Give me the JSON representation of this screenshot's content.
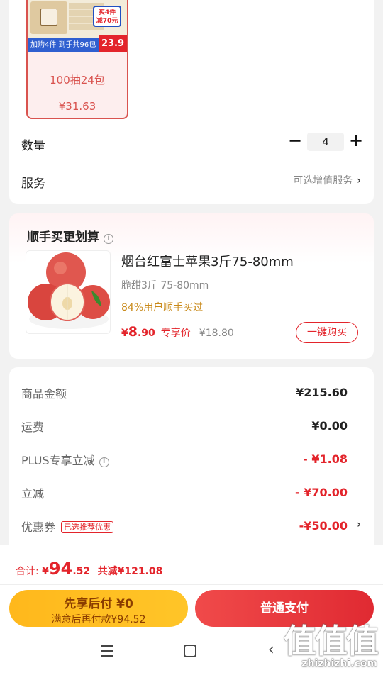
{
  "sku_card": {
    "variant": {
      "promo_badge": "买4件\n减70元",
      "strip_text": "加购4件 到手共96包",
      "price_tag": "23.9",
      "name": "100抽24包",
      "price": "¥31.63"
    },
    "quantity": {
      "label": "数量",
      "minus": "−",
      "value": "4",
      "plus": "+"
    },
    "service": {
      "label": "服务",
      "option": "可选增值服务",
      "chevron": "›"
    }
  },
  "upsell": {
    "title": "顺手买更划算",
    "info_icon": "i",
    "product": {
      "title": "烟台红富士苹果3斤75-80mm",
      "subtitle": "脆甜3斤 75-80mm",
      "social": "84%用户顺手买过",
      "price_symbol": "¥",
      "price_int": "8",
      "price_dec": ".90",
      "price_tag": "专享价",
      "original_price": "¥18.80",
      "buy_button": "一键购买"
    }
  },
  "summary": {
    "rows": [
      {
        "label": "商品金额",
        "value": "¥215.60"
      },
      {
        "label": "运费",
        "value": "¥0.00"
      },
      {
        "label": "PLUS专享立减",
        "value": "- ¥1.08"
      },
      {
        "label": "立减",
        "value": "- ¥70.00"
      },
      {
        "label": "优惠券",
        "tag": "已选推荐优惠",
        "value": "-¥50.00",
        "chevron": "›"
      }
    ],
    "plus_info_icon": "i"
  },
  "checkout": {
    "total_label": "合计:",
    "total_symbol": "¥",
    "total_int": "94",
    "total_dec": ".52",
    "saved": "共减¥121.08",
    "pay_later_line1": "先享后付 ¥0",
    "pay_later_line2": "满意后再付款¥94.52",
    "pay_now": "普通支付"
  },
  "system_nav": {
    "back": "‹"
  },
  "watermark": {
    "big": "值值值",
    "small": "zhizhizhi.com"
  },
  "colors": {
    "accent_red": "#e3242b",
    "pay_later_yellow": "#ffb81c",
    "social_gold": "#c98a1a"
  }
}
